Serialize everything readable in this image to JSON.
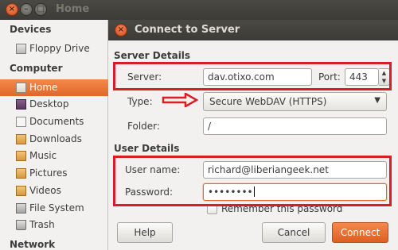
{
  "window": {
    "title": "Home"
  },
  "sidebar": {
    "sections": [
      {
        "label": "Devices",
        "items": [
          {
            "label": "Floppy Drive",
            "icon": "floppy-drive-icon"
          }
        ]
      },
      {
        "label": "Computer",
        "items": [
          {
            "label": "Home",
            "icon": "home-folder-icon",
            "selected": true
          },
          {
            "label": "Desktop",
            "icon": "desktop-folder-icon"
          },
          {
            "label": "Documents",
            "icon": "documents-folder-icon"
          },
          {
            "label": "Downloads",
            "icon": "downloads-folder-icon"
          },
          {
            "label": "Music",
            "icon": "music-folder-icon"
          },
          {
            "label": "Pictures",
            "icon": "pictures-folder-icon"
          },
          {
            "label": "Videos",
            "icon": "videos-folder-icon"
          },
          {
            "label": "File System",
            "icon": "file-system-icon"
          },
          {
            "label": "Trash",
            "icon": "trash-icon"
          }
        ]
      },
      {
        "label": "Network",
        "items": []
      }
    ]
  },
  "dialog": {
    "title": "Connect to Server",
    "server_details": {
      "heading": "Server Details",
      "server_label": "Server:",
      "server_value": "dav.otixo.com",
      "port_label": "Port:",
      "port_value": "443",
      "type_label": "Type:",
      "type_value": "Secure WebDAV (HTTPS)",
      "folder_label": "Folder:",
      "folder_value": "/"
    },
    "user_details": {
      "heading": "User Details",
      "username_label": "User name:",
      "username_value": "richard@liberiangeek.net",
      "password_label": "Password:",
      "password_value": "••••••••",
      "remember_label": "Remember this password",
      "remember_checked": false
    },
    "buttons": {
      "help": "Help",
      "cancel": "Cancel",
      "connect": "Connect"
    }
  },
  "colors": {
    "accent": "#e0672a",
    "titlebar": "#3c3b37",
    "annotation": "#d81d25"
  }
}
